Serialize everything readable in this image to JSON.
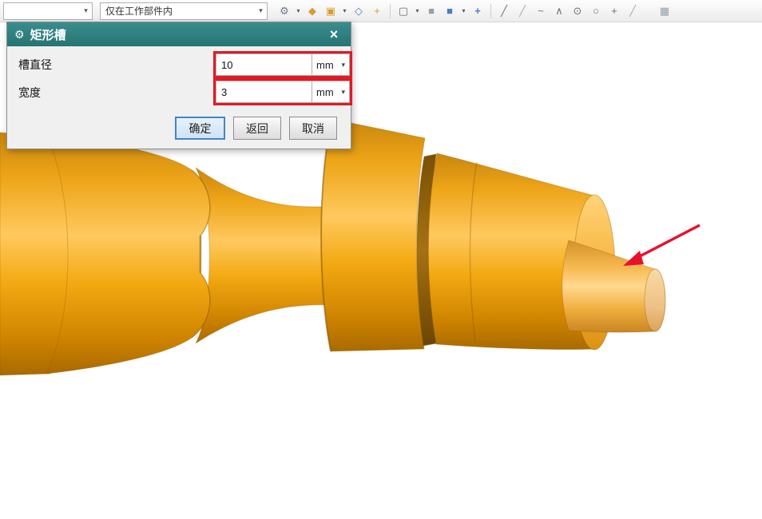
{
  "toolbar": {
    "view_combo": {
      "value": ""
    },
    "scope_combo": {
      "value": "仅在工作部件内"
    },
    "dropdown_glyph": "▾",
    "icons": [
      {
        "name": "interpart-gears-icon",
        "glyph": "⚙"
      },
      {
        "name": "snap-point-icon",
        "glyph": "◆"
      },
      {
        "name": "end-point-icon",
        "glyph": "▣"
      },
      {
        "name": "midpoint-icon",
        "glyph": "◇"
      },
      {
        "name": "intersection-point-icon",
        "glyph": "+"
      },
      {
        "name": "rectangle-select-icon",
        "glyph": "▢"
      },
      {
        "name": "shaded-view-icon",
        "glyph": "■"
      },
      {
        "name": "shaded-cube-icon",
        "glyph": "■"
      },
      {
        "name": "pan-move-icon",
        "glyph": "+"
      },
      {
        "name": "line-icon",
        "glyph": "╱"
      },
      {
        "name": "line-thin-icon",
        "glyph": "╱"
      },
      {
        "name": "spline-icon",
        "glyph": "~"
      },
      {
        "name": "angle-icon",
        "glyph": "∧"
      },
      {
        "name": "point-icon",
        "glyph": "⊙"
      },
      {
        "name": "circle-icon",
        "glyph": "○"
      },
      {
        "name": "plus-icon",
        "glyph": "+"
      },
      {
        "name": "slash-icon",
        "glyph": "╱"
      },
      {
        "name": "grid-icon",
        "glyph": "▦"
      }
    ]
  },
  "dialog": {
    "title": "矩形槽",
    "gear_glyph": "⚙",
    "close_glyph": "×",
    "unit_arrow": "▾",
    "fields": [
      {
        "label": "槽直径",
        "value": "10",
        "unit": "mm"
      },
      {
        "label": "宽度",
        "value": "3",
        "unit": "mm"
      }
    ],
    "buttons": [
      {
        "label": "确定"
      },
      {
        "label": "返回"
      },
      {
        "label": "取消"
      }
    ]
  },
  "annotations": {
    "highlight_color": "#e01b24",
    "arrow_color": "#e8112d"
  },
  "model": {
    "name": "stepped-shaft",
    "color": "#f0a202",
    "titlebar_color": "#2d7f7f"
  }
}
